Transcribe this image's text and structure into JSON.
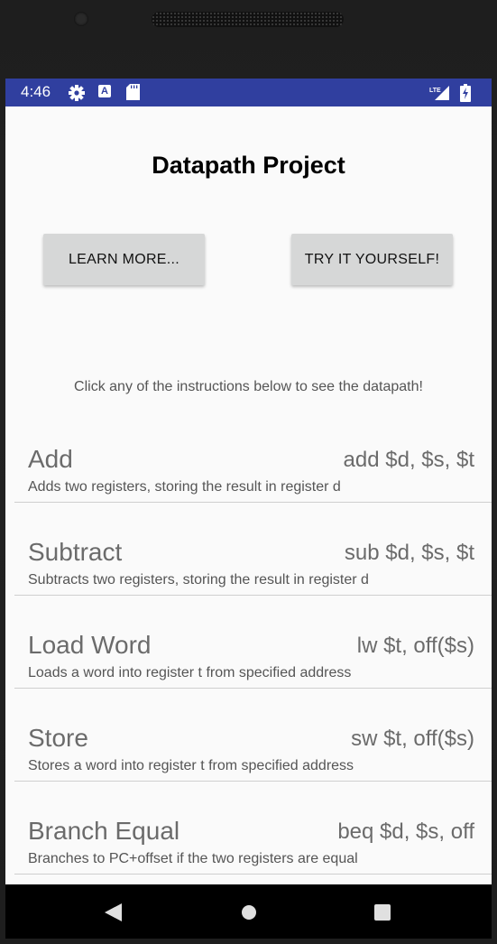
{
  "status_bar": {
    "time": "4:46",
    "background_color": "#303f9f",
    "icons": [
      "gear-icon",
      "a-notification-icon",
      "sd-card-icon",
      "lte-signal-icon",
      "battery-charging-icon"
    ],
    "network_label": "LTE",
    "a_icon_letter": "A"
  },
  "header": {
    "title": "Datapath Project"
  },
  "buttons": {
    "learn_more": "LEARN MORE...",
    "try_it": "TRY IT YOURSELF!"
  },
  "hint": "Click any of the instructions below to see the datapath!",
  "instructions": [
    {
      "name": "Add",
      "syntax": "add $d, $s, $t",
      "description": "Adds two registers, storing the result in register d"
    },
    {
      "name": "Subtract",
      "syntax": "sub $d, $s, $t",
      "description": "Subtracts two registers, storing the result in register d"
    },
    {
      "name": "Load Word",
      "syntax": "lw $t, off($s)",
      "description": "Loads a word into register t from specified address"
    },
    {
      "name": "Store",
      "syntax": "sw $t, off($s)",
      "description": "Stores a word into register t from specified address"
    },
    {
      "name": "Branch Equal",
      "syntax": "beq $d, $s, off",
      "description": "Branches to PC+offset if the two registers are equal"
    }
  ],
  "nav_bar": {
    "icons": [
      "back-icon",
      "home-icon",
      "recent-apps-icon"
    ]
  }
}
